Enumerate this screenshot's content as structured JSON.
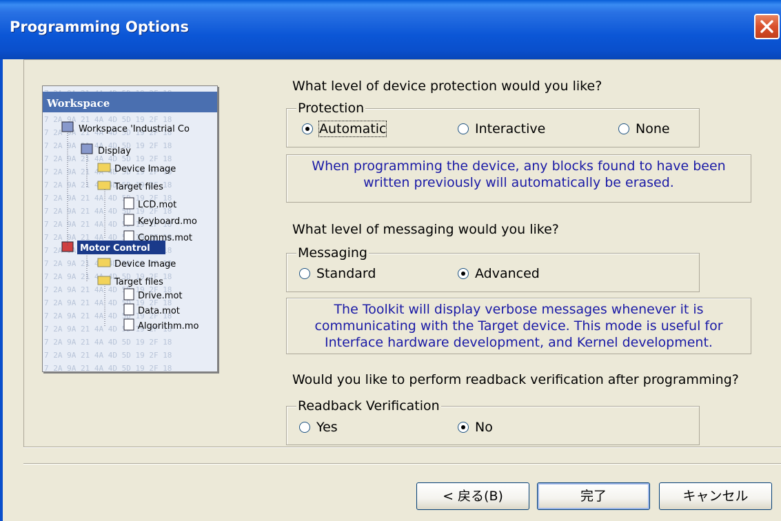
{
  "window": {
    "title": "Programming Options"
  },
  "image_labels": {
    "workspace_header": "Workspace",
    "workspace_root": "Workspace 'Industrial Co",
    "display": "Display",
    "device_image_1": "Device Image",
    "target_files_1": "Target files",
    "lcd": "LCD.mot",
    "keyboard": "Keyboard.mo",
    "comms": "Comms.mot",
    "motor_control": "Motor Control",
    "device_image_2": "Device Image",
    "target_files_2": "Target files",
    "drive": "Drive.mot",
    "data": "Data.mot",
    "algorithm": "Algorithm.mo"
  },
  "protection": {
    "question": "What level of device protection would you like?",
    "legend": "Protection",
    "options": [
      {
        "label": "Automatic",
        "checked": true
      },
      {
        "label": "Interactive",
        "checked": false
      },
      {
        "label": "None",
        "checked": false
      }
    ],
    "info_lines": [
      "When programming the device, any blocks found to have been",
      "written previously will automatically be erased."
    ]
  },
  "messaging": {
    "question": "What level of messaging would you like?",
    "legend": "Messaging",
    "options": [
      {
        "label": "Standard",
        "checked": false
      },
      {
        "label": "Advanced",
        "checked": true
      }
    ],
    "info_lines": [
      "The Toolkit will display verbose messages whenever it is",
      "communicating with the Target device. This mode is useful for",
      "Interface hardware development, and Kernel development."
    ]
  },
  "readback": {
    "question": "Would you like to perform readback verification after programming?",
    "legend": "Readback Verification",
    "options": [
      {
        "label": "Yes",
        "checked": false
      },
      {
        "label": "No",
        "checked": true
      }
    ]
  },
  "buttons": {
    "back": "< 戻る(B)",
    "finish": "完了",
    "cancel": "キャンセル"
  },
  "colors": {
    "title_bar": "#0a4fcc",
    "info_text": "#1a1aa6",
    "dialog_bg": "#ece9d8"
  }
}
